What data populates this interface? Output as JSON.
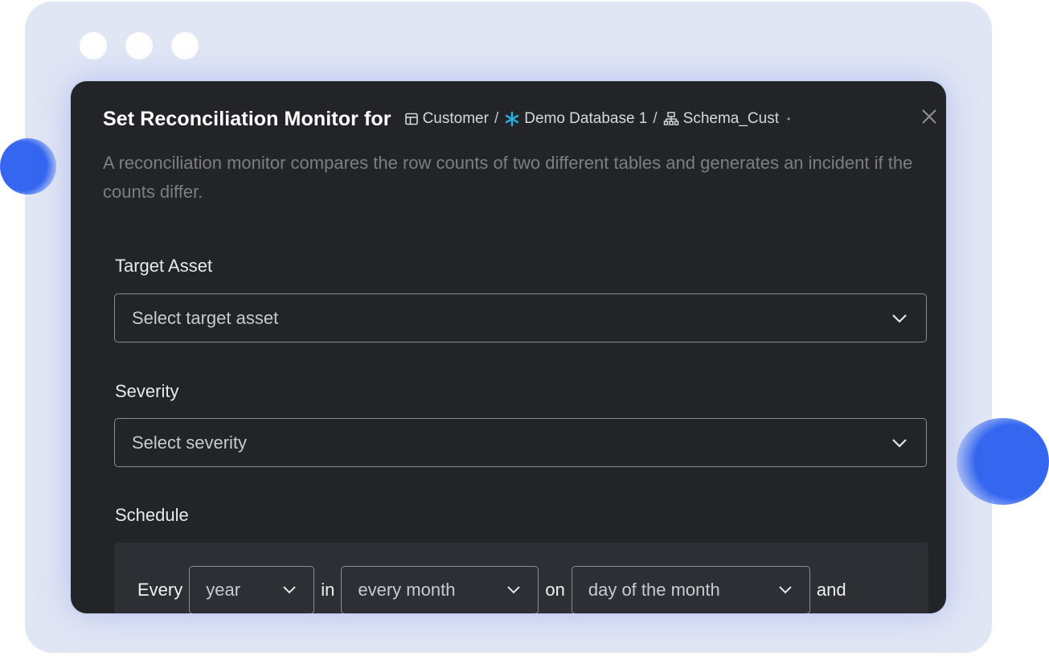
{
  "modal": {
    "title": "Set Reconciliation Monitor for",
    "breadcrumb": [
      {
        "label": "Customer",
        "icon": "table-icon"
      },
      {
        "label": "Demo Database 1",
        "icon": "snowflake-icon"
      },
      {
        "label": "Schema_Cust",
        "icon": "schema-icon"
      }
    ],
    "separator": "/",
    "description": "A reconciliation monitor compares the row counts of two different tables and generates an incident if the counts differ."
  },
  "form": {
    "target_asset": {
      "label": "Target Asset",
      "placeholder": "Select target asset"
    },
    "severity": {
      "label": "Severity",
      "placeholder": "Select severity"
    },
    "schedule": {
      "label": "Schedule",
      "every_word": "Every",
      "period": "year",
      "in_word": "in",
      "month": "every month",
      "on_word": "on",
      "day": "day of the month",
      "and_word": "and"
    }
  },
  "colors": {
    "accent_blue": "#3466f0",
    "modal_bg": "#222428",
    "frame_bg": "#e1e6f5",
    "snowflake": "#29b5e8"
  }
}
